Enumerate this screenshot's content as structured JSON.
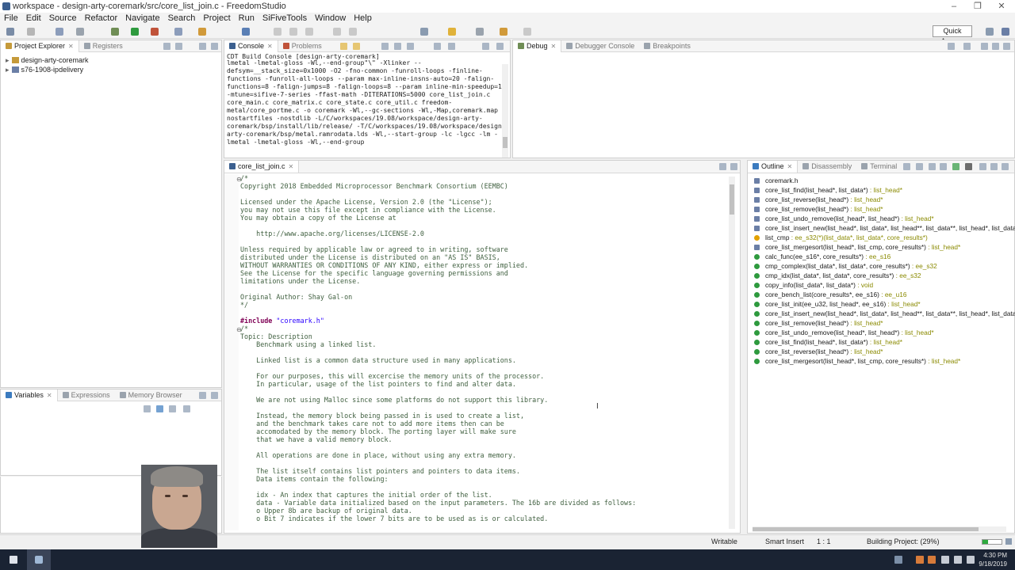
{
  "window": {
    "title": "workspace - design-arty-coremark/src/core_list_join.c - FreedomStudio",
    "controls": [
      "–",
      "❐",
      "✕"
    ]
  },
  "menu": [
    "File",
    "Edit",
    "Source",
    "Refactor",
    "Navigate",
    "Search",
    "Project",
    "Run",
    "SiFiveTools",
    "Window",
    "Help"
  ],
  "toolbar": {
    "quick_access": "Quick Access"
  },
  "project_explorer": {
    "tabs": [
      "Project Explorer",
      "Registers"
    ],
    "items": [
      "design-arty-coremark",
      "s76-1908-ipdelivery"
    ]
  },
  "variables_pane": {
    "tabs": [
      "Variables",
      "Expressions",
      "Memory Browser"
    ]
  },
  "console": {
    "tabs": [
      "Console",
      "Problems"
    ],
    "header": "CDT Build Console [design-arty-coremark]",
    "lines": [
      "lmetal -lmetal-gloss -Wl,--end-group\"\\\" -Xlinker --",
      "defsym=__stack_size=0x1000 -O2 -fno-common -funroll-loops -finline-",
      "functions -funroll-all-loops --param max-inline-insns-auto=20 -falign-",
      "functions=8 -falign-jumps=8 -falign-loops=8 --param inline-min-speedup=10",
      "-mtune=sifive-7-series -ffast-math -DITERATIONS=5000 core_list_join.c",
      "core_main.c core_matrix.c core_state.c core_util.c freedom-",
      "metal/core_portme.c -o coremark -Wl,--gc-sections -Wl,-Map,coremark.map -",
      "nostartfiles -nostdlib -L/C/workspaces/19.08/workspace/design-arty-",
      "coremark/bsp/install/lib/release/ -T/C/workspaces/19.08/workspace/design-",
      "arty-coremark/bsp/metal.ramrodata.lds -Wl,--start-group -lc -lgcc -lm -",
      "lmetal -lmetal-gloss -Wl,--end-group"
    ]
  },
  "debug_pane": {
    "tabs": [
      "Debug",
      "Debugger Console",
      "Breakpoints"
    ]
  },
  "editor": {
    "tab": "core_list_join.c",
    "lines": [
      {
        "c": "cm",
        "t": "/*"
      },
      {
        "c": "cm",
        "t": "Copyright 2018 Embedded Microprocessor Benchmark Consortium (EEMBC)"
      },
      {
        "c": "cm",
        "t": ""
      },
      {
        "c": "cm",
        "t": "Licensed under the Apache License, Version 2.0 (the \"License\");"
      },
      {
        "c": "cm",
        "t": "you may not use this file except in compliance with the License."
      },
      {
        "c": "cm",
        "t": "You may obtain a copy of the License at"
      },
      {
        "c": "cm",
        "t": ""
      },
      {
        "c": "cm",
        "t": "    http://www.apache.org/licenses/LICENSE-2.0"
      },
      {
        "c": "cm",
        "t": ""
      },
      {
        "c": "cm",
        "t": "Unless required by applicable law or agreed to in writing, software"
      },
      {
        "c": "cm",
        "t": "distributed under the License is distributed on an \"AS IS\" BASIS,"
      },
      {
        "c": "cm",
        "t": "WITHOUT WARRANTIES OR CONDITIONS OF ANY KIND, either express or implied."
      },
      {
        "c": "cm",
        "t": "See the License for the specific language governing permissions and"
      },
      {
        "c": "cm",
        "t": "limitations under the License."
      },
      {
        "c": "cm",
        "t": ""
      },
      {
        "c": "cm",
        "t": "Original Author: Shay Gal-on"
      },
      {
        "c": "cm",
        "t": "*/"
      },
      {
        "c": "",
        "t": ""
      },
      {
        "c": "inc",
        "t": "\"coremark.h\""
      },
      {
        "c": "cm",
        "t": "/*"
      },
      {
        "c": "cm",
        "t": "Topic: Description"
      },
      {
        "c": "cm",
        "t": "    Benchmark using a linked list."
      },
      {
        "c": "cm",
        "t": ""
      },
      {
        "c": "cm",
        "t": "    Linked list is a common data structure used in many applications."
      },
      {
        "c": "cm",
        "t": ""
      },
      {
        "c": "cm",
        "t": "    For our purposes, this will excercise the memory units of the processor."
      },
      {
        "c": "cm",
        "t": "    In particular, usage of the list pointers to find and alter data."
      },
      {
        "c": "cm",
        "t": ""
      },
      {
        "c": "cm",
        "t": "    We are not using Malloc since some platforms do not support this library."
      },
      {
        "c": "cm",
        "t": ""
      },
      {
        "c": "cm",
        "t": "    Instead, the memory block being passed in is used to create a list,"
      },
      {
        "c": "cm",
        "t": "    and the benchmark takes care not to add more items then can be"
      },
      {
        "c": "cm",
        "t": "    accomodated by the memory block. The porting layer will make sure"
      },
      {
        "c": "cm",
        "t": "    that we have a valid memory block."
      },
      {
        "c": "cm",
        "t": ""
      },
      {
        "c": "cm",
        "t": "    All operations are done in place, without using any extra memory."
      },
      {
        "c": "cm",
        "t": ""
      },
      {
        "c": "cm",
        "t": "    The list itself contains list pointers and pointers to data items."
      },
      {
        "c": "cm",
        "t": "    Data items contain the following:"
      },
      {
        "c": "cm",
        "t": ""
      },
      {
        "c": "cm",
        "t": "    idx - An index that captures the initial order of the list."
      },
      {
        "c": "cm",
        "t": "    data - Variable data initialized based on the input parameters. The 16b are divided as follows:"
      },
      {
        "c": "cm",
        "t": "    o Upper 8b are backup of original data."
      },
      {
        "c": "cm",
        "t": "    o Bit 7 indicates if the lower 7 bits are to be used as is or calculated."
      }
    ],
    "include_kw": "#include"
  },
  "outline": {
    "tabs": [
      "Outline",
      "Disassembly",
      "Terminal"
    ],
    "items": [
      {
        "k": "hdr",
        "n": "coremark.h",
        "t": ""
      },
      {
        "k": "hdr",
        "n": "core_list_find(list_head*, list_data*)",
        "t": " : list_head*"
      },
      {
        "k": "hdr",
        "n": "core_list_reverse(list_head*)",
        "t": " : list_head*"
      },
      {
        "k": "hdr",
        "n": "core_list_remove(list_head*)",
        "t": " : list_head*"
      },
      {
        "k": "hdr",
        "n": "core_list_undo_remove(list_head*, list_head*)",
        "t": " : list_head*"
      },
      {
        "k": "hdr",
        "n": "core_list_insert_new(list_head*, list_data*, list_head**, list_data**, list_head*, list_data*)",
        "t": ""
      },
      {
        "k": "warn",
        "n": "list_cmp",
        "t": " : ee_s32(*)(list_data*, list_data*, core_results*)"
      },
      {
        "k": "hdr",
        "n": "core_list_mergesort(list_head*, list_cmp, core_results*)",
        "t": " : list_head*"
      },
      {
        "k": "fn",
        "n": "calc_func(ee_s16*, core_results*)",
        "t": " : ee_s16"
      },
      {
        "k": "fn",
        "n": "cmp_complex(list_data*, list_data*, core_results*)",
        "t": " : ee_s32"
      },
      {
        "k": "fn",
        "n": "cmp_idx(list_data*, list_data*, core_results*)",
        "t": " : ee_s32"
      },
      {
        "k": "fn",
        "n": "copy_info(list_data*, list_data*)",
        "t": " : void"
      },
      {
        "k": "fn",
        "n": "core_bench_list(core_results*, ee_s16)",
        "t": " : ee_u16"
      },
      {
        "k": "fn",
        "n": "core_list_init(ee_u32, list_head*, ee_s16)",
        "t": " : list_head*"
      },
      {
        "k": "fn",
        "n": "core_list_insert_new(list_head*, list_data*, list_head**, list_data**, list_head*, list_data*)",
        "t": ""
      },
      {
        "k": "fn",
        "n": "core_list_remove(list_head*)",
        "t": " : list_head*"
      },
      {
        "k": "fn",
        "n": "core_list_undo_remove(list_head*, list_head*)",
        "t": " : list_head*"
      },
      {
        "k": "fn",
        "n": "core_list_find(list_head*, list_data*)",
        "t": " : list_head*"
      },
      {
        "k": "fn",
        "n": "core_list_reverse(list_head*)",
        "t": " : list_head*"
      },
      {
        "k": "fn",
        "n": "core_list_mergesort(list_head*, list_cmp, core_results*)",
        "t": " : list_head*"
      }
    ]
  },
  "status": {
    "writable": "Writable",
    "insert": "Smart Insert",
    "position": "1 : 1",
    "build": "Building Project: (29%)",
    "build_progress": 0.29
  },
  "clock": {
    "time": "4:30 PM",
    "date": "9/18/2019"
  }
}
